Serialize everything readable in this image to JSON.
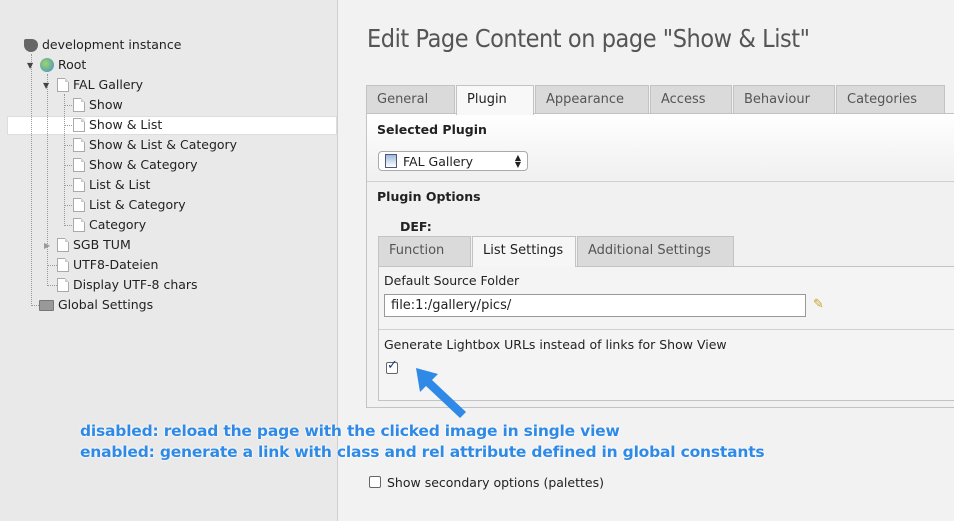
{
  "tree": {
    "instance": "development instance",
    "root": "Root",
    "fal_gallery": "FAL Gallery",
    "children": [
      "Show",
      "Show & List",
      "Show & List & Category",
      "Show & Category",
      "List & List",
      "List & Category",
      "Category"
    ],
    "siblings": [
      "SGB TUM",
      "UTF8-Dateien",
      "Display UTF-8 chars"
    ],
    "global": "Global Settings",
    "selected": "Show & List"
  },
  "header": {
    "title": "Edit Page Content on page \"Show & List\""
  },
  "tabs": [
    "General",
    "Plugin",
    "Appearance",
    "Access",
    "Behaviour",
    "Categories"
  ],
  "active_tab": "Plugin",
  "plugin": {
    "section": "Selected Plugin",
    "value": "FAL Gallery"
  },
  "options": {
    "section": "Plugin Options",
    "sheet": "DEF:",
    "tabs": [
      "Function",
      "List Settings",
      "Additional Settings"
    ],
    "active_tab": "List Settings",
    "folder_label": "Default Source Folder",
    "folder_value": "file:1:/gallery/pics/",
    "lightbox_label": "Generate Lightbox URLs instead of links for Show View",
    "lightbox_checked": true
  },
  "annotation": {
    "line1": "disabled: reload the page with the clicked image in single view",
    "line2": "enabled: generate a link with class and rel attribute defined in global constants",
    "color": "#2e8ae6"
  },
  "palettes": {
    "label": "Show secondary options (palettes)",
    "checked": false
  }
}
